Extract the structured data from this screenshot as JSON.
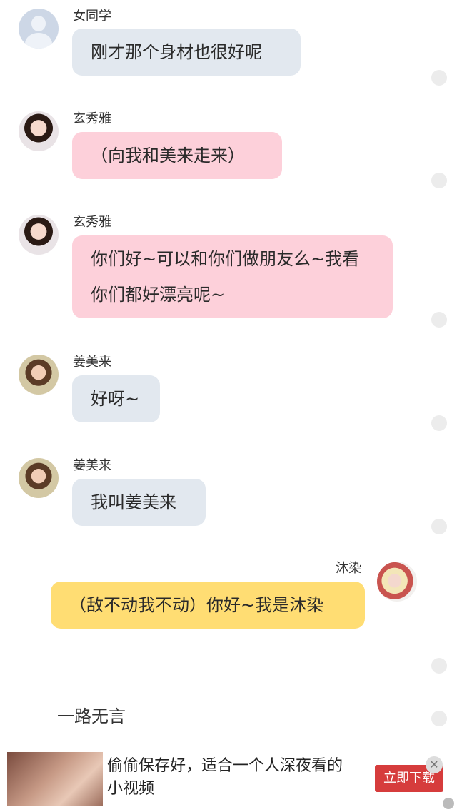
{
  "messages": [
    {
      "sender": "女同学",
      "text": "刚才那个身材也很好呢"
    },
    {
      "sender": "玄秀雅",
      "text": "（向我和美来走来）"
    },
    {
      "sender": "玄秀雅",
      "text": "你们好~可以和你们做朋友么~我看你们都好漂亮呢~"
    },
    {
      "sender": "姜美来",
      "text": "好呀~"
    },
    {
      "sender": "姜美来",
      "text": "我叫姜美来"
    },
    {
      "sender": "沐染",
      "text": "（敌不动我不动）你好~我是沐染"
    }
  ],
  "narration": "一路无言",
  "ad": {
    "text": "偷偷保存好，适合一个人深夜看的小视频",
    "button_label": "立即下载",
    "close_symbol": "✕"
  },
  "colors": {
    "gray_bubble": "#e2e8ef",
    "pink_bubble": "#fdd0da",
    "yellow_bubble": "#ffdd73",
    "ad_button": "#d63c3c"
  }
}
